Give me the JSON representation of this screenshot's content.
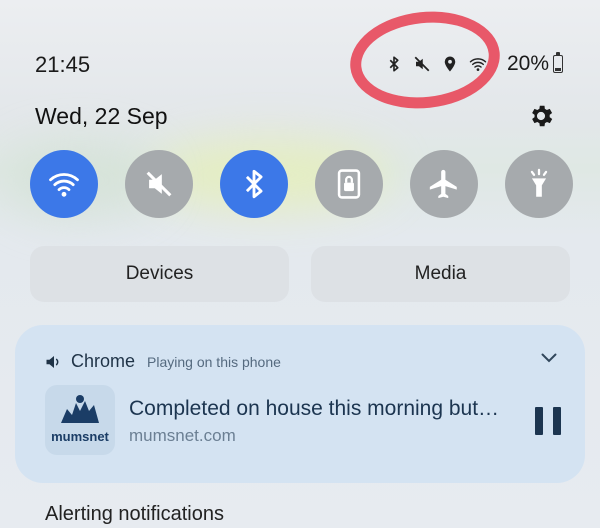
{
  "status_bar": {
    "time": "21:45",
    "battery": "20%",
    "battery_level": 0.2,
    "icons": [
      "bluetooth-icon",
      "mute-icon",
      "location-icon",
      "wifi-icon"
    ]
  },
  "header": {
    "date": "Wed, 22 Sep"
  },
  "quick_toggles": [
    {
      "name": "wifi",
      "state": "on"
    },
    {
      "name": "sound-mute",
      "state": "off"
    },
    {
      "name": "bluetooth",
      "state": "on"
    },
    {
      "name": "screen-lock",
      "state": "off"
    },
    {
      "name": "airplane-mode",
      "state": "off"
    },
    {
      "name": "flashlight",
      "state": "off"
    }
  ],
  "buttons": {
    "devices": "Devices",
    "media": "Media"
  },
  "media_card": {
    "app": "Chrome",
    "subtitle": "Playing on this phone",
    "title": "Completed on house this morning but…",
    "source": "mumsnet.com",
    "thumb_text": "mumsnet"
  },
  "section": {
    "alerting": "Alerting notifications"
  },
  "colors": {
    "toggle_on": "#3c78e8",
    "toggle_off": "#a6aaad",
    "annotation": "#e8485a",
    "card_bg": "#d4e3f2"
  }
}
